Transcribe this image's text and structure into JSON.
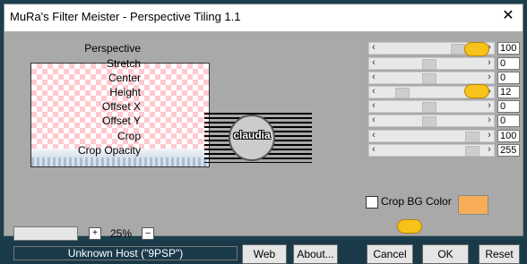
{
  "window": {
    "title": "MuRa's Filter Meister - Perspective Tiling 1.1",
    "close_glyph": "✕"
  },
  "controls": [
    {
      "label": "Perspective",
      "value": "100",
      "thumb_level": 0.78
    },
    {
      "label": "Stretch",
      "value": "0",
      "thumb_level": 0.47
    },
    {
      "label": "Center",
      "value": "0",
      "thumb_level": 0.47
    },
    {
      "label": "Height",
      "value": "12",
      "thumb_level": 0.17
    },
    {
      "label": "Offset X",
      "value": "0",
      "thumb_level": 0.47
    },
    {
      "label": "Offset Y",
      "value": "0",
      "thumb_level": 0.47
    },
    {
      "label": "Crop",
      "value": "100",
      "thumb_level": 0.93
    },
    {
      "label": "Crop Opacity",
      "value": "255",
      "thumb_level": 0.93
    }
  ],
  "logo": {
    "text": "claudia"
  },
  "crop_bg": {
    "label": "Crop BG Color",
    "color": "#f6ad55"
  },
  "zoom": {
    "value": "25%",
    "plus": "+",
    "minus": "–"
  },
  "status": {
    "text": "Unknown Host (\"9PSP\")"
  },
  "buttons": {
    "web": "Web",
    "about": "About...",
    "cancel": "Cancel",
    "ok": "OK",
    "reset": "Reset"
  },
  "colors": {
    "client": "#a9a9a9",
    "checker": "#ffc9cf"
  }
}
